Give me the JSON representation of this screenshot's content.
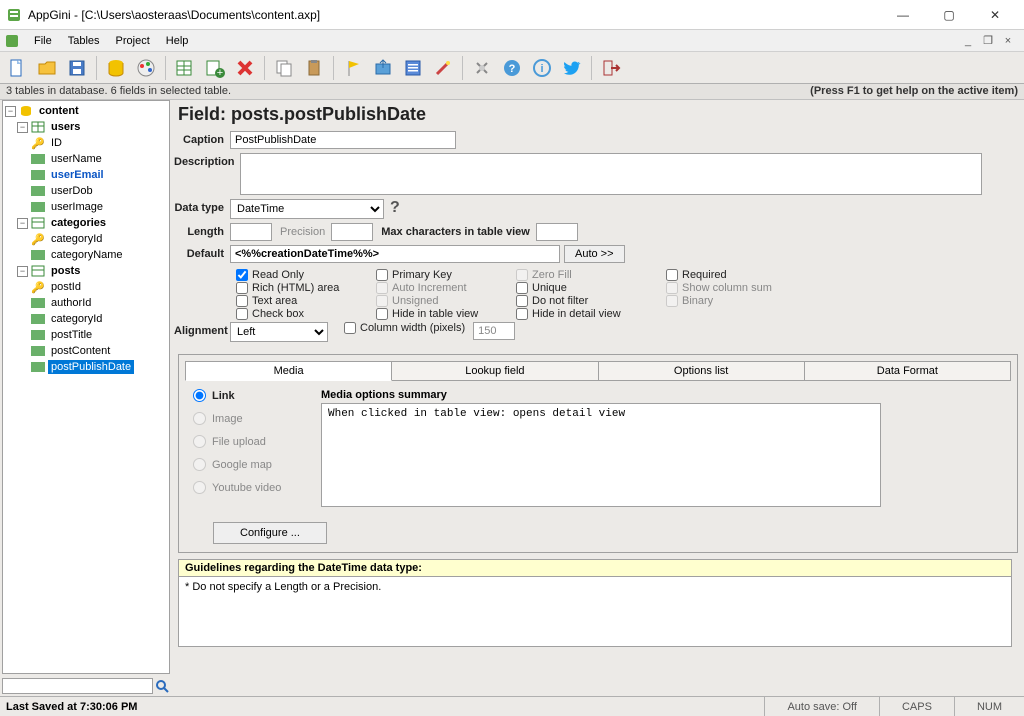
{
  "window": {
    "title": "AppGini - [C:\\Users\\aosteraas\\Documents\\content.axp]",
    "help_hint": "(Press F1 to get help on the active item)"
  },
  "menu": {
    "file": "File",
    "tables": "Tables",
    "project": "Project",
    "help": "Help"
  },
  "status_line": "3 tables in database. 6 fields in selected table.",
  "tree": {
    "root": "content",
    "tables": [
      {
        "name": "users",
        "fields": [
          "ID",
          "userName",
          "userEmail",
          "userDob",
          "userImage"
        ],
        "lookup_idx": 2
      },
      {
        "name": "categories",
        "fields": [
          "categoryId",
          "categoryName"
        ]
      },
      {
        "name": "posts",
        "fields": [
          "postId",
          "authorId",
          "categoryId",
          "postTitle",
          "postContent",
          "postPublishDate"
        ],
        "selected_idx": 5
      }
    ]
  },
  "field": {
    "heading": "Field: posts.postPublishDate",
    "labels": {
      "caption": "Caption",
      "description": "Description",
      "datatype": "Data type",
      "length": "Length",
      "precision": "Precision",
      "maxchars": "Max characters in table view",
      "default": "Default",
      "auto": "Auto >>",
      "alignment": "Alignment"
    },
    "caption_value": "PostPublishDate",
    "datatype_value": "DateTime",
    "default_value": "<%%creationDateTime%%>",
    "alignment_value": "Left",
    "checks": {
      "readonly": "Read Only",
      "rich": "Rich (HTML) area",
      "textarea": "Text area",
      "checkbox": "Check box",
      "pk": "Primary Key",
      "autoinc": "Auto Increment",
      "unsigned": "Unsigned",
      "hide_table": "Hide in table view",
      "colwidth": "Column width (pixels)",
      "zerofill": "Zero Fill",
      "unique": "Unique",
      "nofilter": "Do not filter",
      "hide_detail": "Hide in detail view",
      "required": "Required",
      "showcolsum": "Show column sum",
      "binary": "Binary"
    },
    "colwidth_value": "150"
  },
  "tabs": {
    "media": "Media",
    "lookup": "Lookup field",
    "options": "Options list",
    "format": "Data Format"
  },
  "media": {
    "radios": {
      "link": "Link",
      "image": "Image",
      "file": "File upload",
      "gmap": "Google map",
      "youtube": "Youtube video"
    },
    "summary_label": "Media options summary",
    "summary_text": "When clicked in table view: opens detail view",
    "configure": "Configure ..."
  },
  "guidelines": {
    "header": "Guidelines regarding the DateTime data type:",
    "body": "* Do not specify a Length or a Precision."
  },
  "footer": {
    "saved": "Last Saved at 7:30:06 PM",
    "autosave": "Auto save: Off",
    "caps": "CAPS",
    "num": "NUM"
  }
}
